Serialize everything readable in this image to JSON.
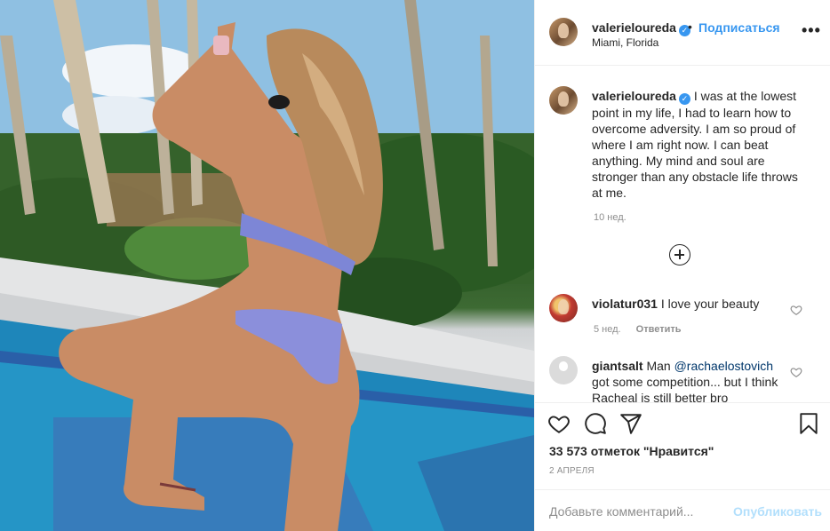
{
  "post": {
    "image_description": "",
    "author": {
      "username": "valerieloureda",
      "verified_icon": "verified-badge-icon",
      "location": "Miami, Florida"
    },
    "header": {
      "dot": "•",
      "follow_label": "Подписаться",
      "more_icon": "more-horizontal-icon",
      "more_label": "•••"
    },
    "caption": {
      "username": "valerieloureda",
      "text": "I was at the lowest point in my life, I had to learn how to overcome adversity. I am so proud of where I am right now. I can beat anything. My mind and soul are stronger than any obstacle life throws at me.",
      "time": "10 нед."
    },
    "load_more_icon": "plus-circle-icon",
    "comments": [
      {
        "username": "violatur031",
        "text": "I love your beauty",
        "time": "5 нед.",
        "reply_label": "Ответить"
      },
      {
        "username": "giantsalt",
        "text_before": "Man ",
        "mention": "@rachaelostovich",
        "text_after": " got some competition... but I think Racheal is still better bro"
      }
    ],
    "actions": {
      "like_icon": "heart-icon",
      "comment_icon": "comment-icon",
      "share_icon": "share-plane-icon",
      "save_icon": "bookmark-icon"
    },
    "likes_text": "33 573 отметок \"Нравится\"",
    "date": "2 АПРЕЛЯ",
    "add_comment": {
      "placeholder": "Добавьте комментарий...",
      "publish_label": "Опубликовать"
    },
    "colors": {
      "accent": "#3897f0",
      "publish_disabled": "#b2dffc",
      "meta": "#8e8e8e",
      "text": "#262626",
      "border": "#efefef"
    }
  }
}
